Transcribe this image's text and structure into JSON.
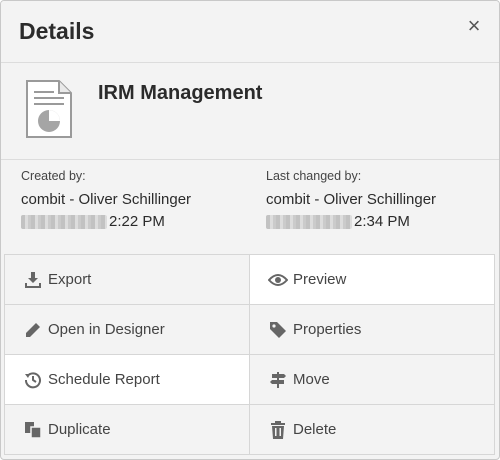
{
  "dialog": {
    "title": "Details",
    "close_label": "×"
  },
  "report": {
    "name": "IRM Management",
    "icon": "report-document-icon"
  },
  "created": {
    "label": "Created by:",
    "user": "combit - Oliver Schillinger",
    "time": "2:22 PM"
  },
  "changed": {
    "label": "Last changed by:",
    "user": "combit - Oliver Schillinger",
    "time": "2:34 PM"
  },
  "actions": {
    "export": "Export",
    "preview": "Preview",
    "open_designer": "Open in Designer",
    "properties": "Properties",
    "schedule": "Schedule Report",
    "move": "Move",
    "duplicate": "Duplicate",
    "delete": "Delete"
  },
  "colors": {
    "background": "#f3f3f3",
    "button_white": "#ffffff",
    "icon": "#666666",
    "border": "#d6d6d6"
  }
}
